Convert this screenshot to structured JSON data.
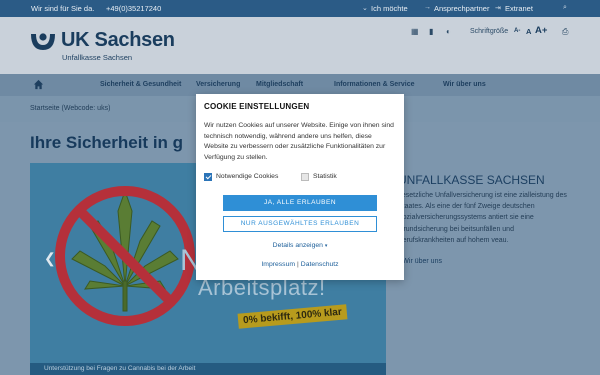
{
  "topbar": {
    "tagline": "Wir sind für Sie da.",
    "phone": "+49(0)35217240",
    "links": [
      "Ich möchte",
      "Ansprechpartner",
      "Extranet"
    ]
  },
  "header": {
    "logo_title": "UK Sachsen",
    "logo_subtitle": "Unfallkasse Sachsen",
    "font_size_label": "Schriftgröße",
    "font_sizes": [
      "A-",
      "A",
      "A+"
    ]
  },
  "nav": {
    "items": [
      "Sicherheit & Gesundheit",
      "Versicherung",
      "Mitgliedschaft",
      "Informationen & Service",
      "Wir über uns"
    ]
  },
  "breadcrumb": "Startseite (Webcode: uks)",
  "main": {
    "title": "Ihre Sicherheit in g",
    "hero_text_1": "N",
    "hero_text_2": "Arbeitsplatz!",
    "hero_tag": "0% bekifft, 100% klar",
    "hero_caption": "Unterstützung bei Fragen zu Cannabis bei der Arbeit",
    "side_title": "UNFALLKASSE SACHSEN",
    "side_text": "gesetzliche Unfallversicherung ist eine zialleistung des Staates. Als eine der fünf Zweige deutschen Sozialversicherungssystems antiert sie eine Grundsicherung bei beitsunfällen und Berufskrankheiten auf hohem veau.",
    "side_link": "Wir über uns"
  },
  "cookie_modal": {
    "title": "COOKIE EINSTELLUNGEN",
    "text": "Wir nutzen Cookies auf unserer Website. Einige von ihnen sind technisch notwendig, während andere uns helfen, diese Website zu verbessern oder zusätzliche Funktionalitäten zur Verfügung zu stellen.",
    "checkbox_necessary": "Notwendige Cookies",
    "checkbox_statistics": "Statistik",
    "accept_all": "JA, ALLE ERLAUBEN",
    "accept_selected": "NUR AUSGEWÄHLTES ERLAUBEN",
    "details": "Details anzeigen",
    "impressum": "Impressum",
    "separator": "|",
    "privacy": "Datenschutz"
  },
  "colors": {
    "accent": "#2f8fd6",
    "brand_dark": "#1a3d5e",
    "topbar": "#2b5b86"
  }
}
